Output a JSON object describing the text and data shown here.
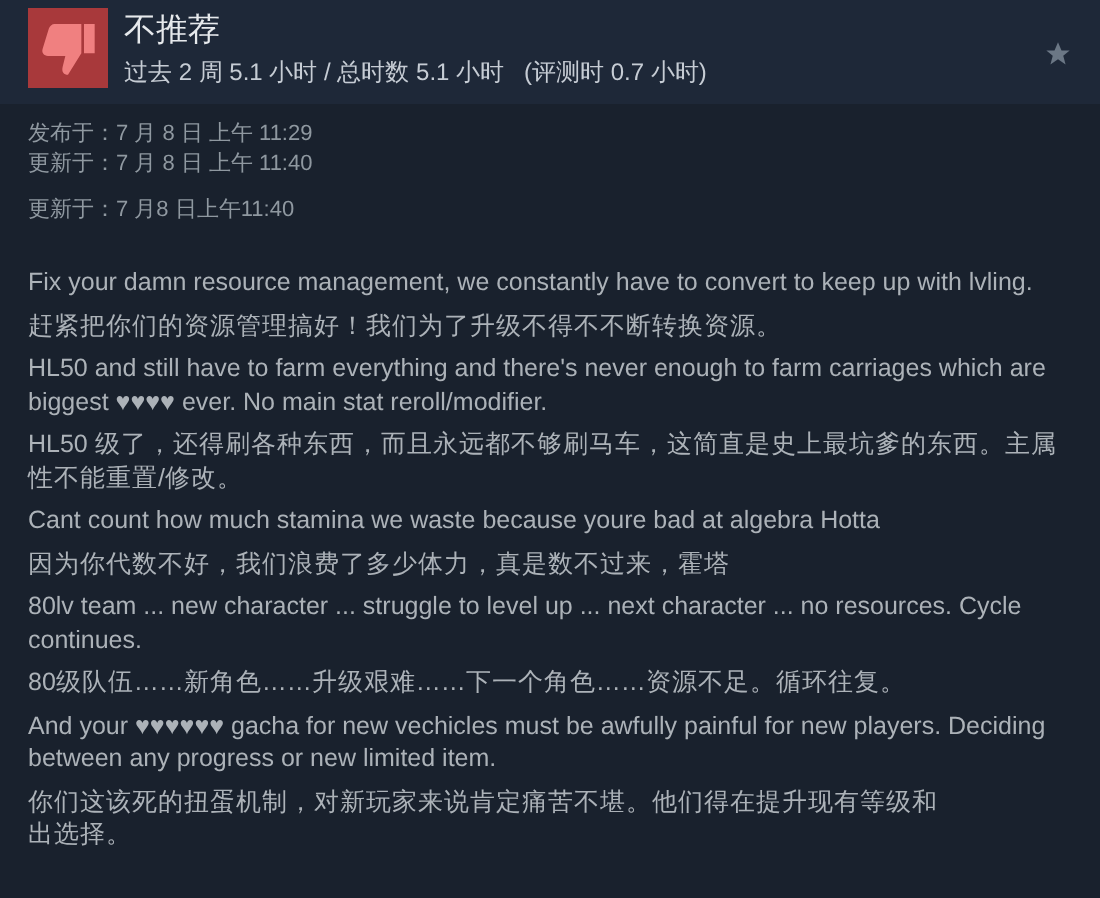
{
  "review": {
    "verdict": "不推荐",
    "recommended": false,
    "playtime": "过去 2 周 5.1 小时 / 总时数 5.1 小时",
    "playtime_at_review": "(评测时 0.7 小时)"
  },
  "dates": [
    {
      "text": "发布于：7 月 8 日 上午 11:29"
    },
    {
      "text": "更新于：7 月 8 日 上午 11:40"
    },
    {
      "text": "更新于：7 月8 日上午11:40"
    }
  ],
  "paragraphs": [
    {
      "lines": [
        "Fix your damn resource management, we constantly have to convert to keep up with lvling."
      ]
    },
    {
      "lines": [
        "赶紧把你们的资源管理搞好！我们为了升级不得不不断转换资源。"
      ]
    },
    {
      "lines": [
        "HL50 and still have to farm everything and there's never enough to farm carriages which are biggest ♥♥♥♥ ever. No main stat reroll/modifier."
      ]
    },
    {
      "lines": [
        "HL50 级了，还得刷各种东西，而且永远都不够刷马车，这简直是史上最坑爹的东西。主属性不能重置/修改。"
      ]
    },
    {
      "lines": [
        "Cant count how much stamina we waste because youre bad at algebra Hotta"
      ]
    },
    {
      "lines": [
        "因为你代数不好，我们浪费了多少体力，真是数不过来，霍塔"
      ]
    },
    {
      "lines": [
        "80lv team ... new character ... struggle to level up ... next character ... no resources. Cycle continues."
      ]
    },
    {
      "lines": [
        "80级队伍……新角色……升级艰难……下一个角色……资源不足。循环往复。"
      ]
    },
    {
      "lines": [
        "And your ♥♥♥♥♥♥ gacha for new vechicles must be awfully painful for new players. Deciding between any progress or new limited item."
      ]
    },
    {
      "lines": [
        "你们这该死的扭蛋机制，对新玩家来说肯定痛苦不堪。他们得在提升现有等级和",
        "出选择。"
      ]
    }
  ]
}
